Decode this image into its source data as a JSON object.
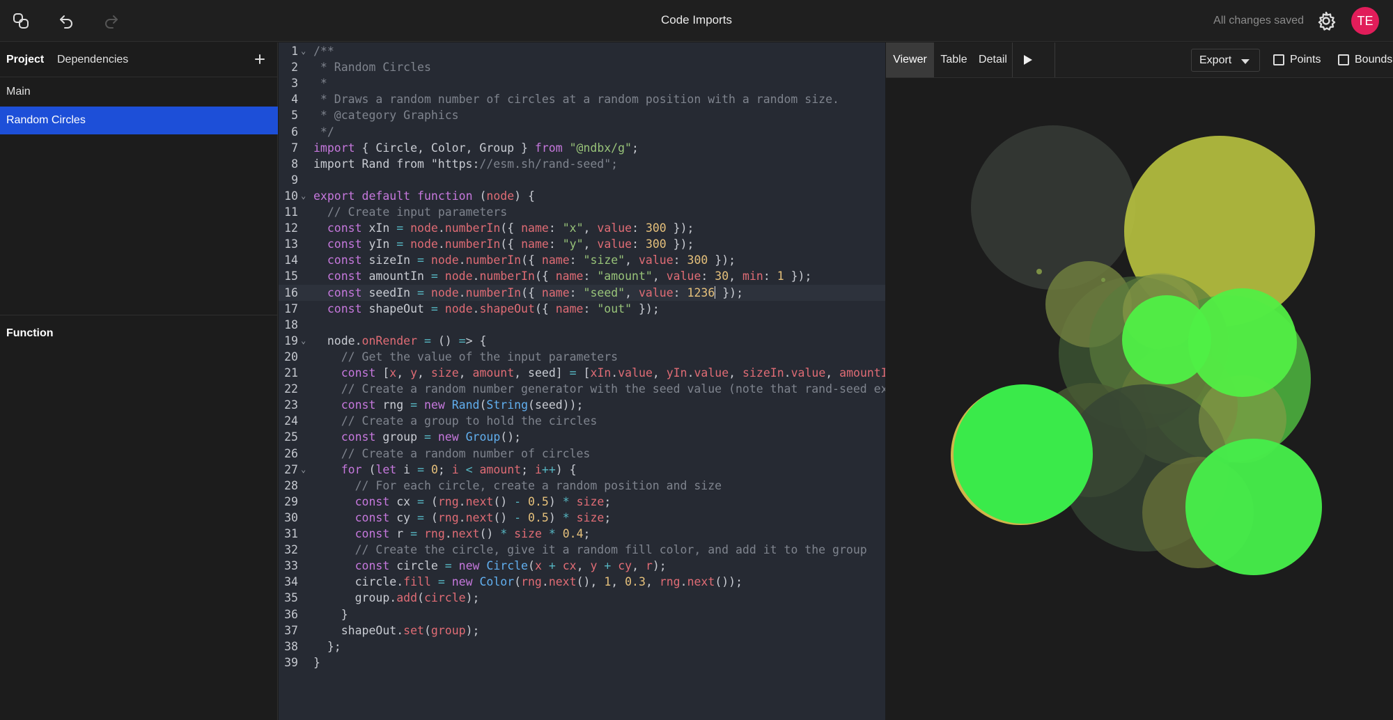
{
  "header": {
    "title": "Code Imports",
    "status": "All changes saved",
    "avatar_initials": "TE"
  },
  "sidebar": {
    "tabs": [
      {
        "label": "Project"
      },
      {
        "label": "Dependencies"
      }
    ],
    "items": [
      {
        "label": "Main"
      },
      {
        "label": "Random Circles"
      }
    ],
    "section_title": "Function"
  },
  "editor": {
    "line_numbers": [
      "1",
      "2",
      "3",
      "4",
      "5",
      "6",
      "7",
      "8",
      "9",
      "10",
      "11",
      "12",
      "13",
      "14",
      "15",
      "16",
      "17",
      "18",
      "19",
      "20",
      "21",
      "22",
      "23",
      "24",
      "25",
      "26",
      "27",
      "28",
      "29",
      "30",
      "31",
      "32",
      "33",
      "34",
      "35",
      "36",
      "37",
      "38",
      "39"
    ],
    "lines": [
      "/**",
      " * Random Circles",
      " *",
      " * Draws a random number of circles at a random position with a random size.",
      " * @category Graphics",
      " */",
      "import { Circle, Color, Group } from \"@ndbx/g\";",
      "import Rand from \"https://esm.sh/rand-seed\";",
      "",
      "export default function (node) {",
      "  // Create input parameters",
      "  const xIn = node.numberIn({ name: \"x\", value: 300 });",
      "  const yIn = node.numberIn({ name: \"y\", value: 300 });",
      "  const sizeIn = node.numberIn({ name: \"size\", value: 300 });",
      "  const amountIn = node.numberIn({ name: \"amount\", value: 30, min: 1 });",
      "  const seedIn = node.numberIn({ name: \"seed\", value: 1236 });",
      "  const shapeOut = node.shapeOut({ name: \"out\" });",
      "",
      "  node.onRender = () => {",
      "    // Get the value of the input parameters",
      "    const [x, y, size, amount, seed] = [xIn.value, yIn.value, sizeIn.value, amountI",
      "    // Create a random number generator with the seed value (note that rand-seed ex",
      "    const rng = new Rand(String(seed));",
      "    // Create a group to hold the circles",
      "    const group = new Group();",
      "    // Create a random number of circles",
      "    for (let i = 0; i < amount; i++) {",
      "      // For each circle, create a random position and size",
      "      const cx = (rng.next() - 0.5) * size;",
      "      const cy = (rng.next() - 0.5) * size;",
      "      const r = rng.next() * size * 0.4;",
      "      // Create the circle, give it a random fill color, and add it to the group",
      "      const circle = new Circle(x + cx, y + cy, r);",
      "      circle.fill = new Color(rng.next(), 1, 0.3, rng.next());",
      "      group.add(circle);",
      "    }",
      "    shapeOut.set(group);",
      "  };",
      "}"
    ]
  },
  "viewer": {
    "tabs": [
      {
        "label": "Viewer"
      },
      {
        "label": "Table"
      },
      {
        "label": "Detail"
      }
    ],
    "export_label": "Export",
    "checkboxes": [
      {
        "label": "Points",
        "checked": false
      },
      {
        "label": "Bounds",
        "checked": false
      }
    ]
  },
  "colors": {
    "selection": "#1d4fd8",
    "avatar": "#e11d5a",
    "editor_bg": "#262a33"
  },
  "icons": [
    "logo-icon",
    "undo-icon",
    "redo-icon",
    "gear-icon",
    "plus-icon",
    "play-icon",
    "chevron-down-icon",
    "fold-chevron-icon"
  ]
}
